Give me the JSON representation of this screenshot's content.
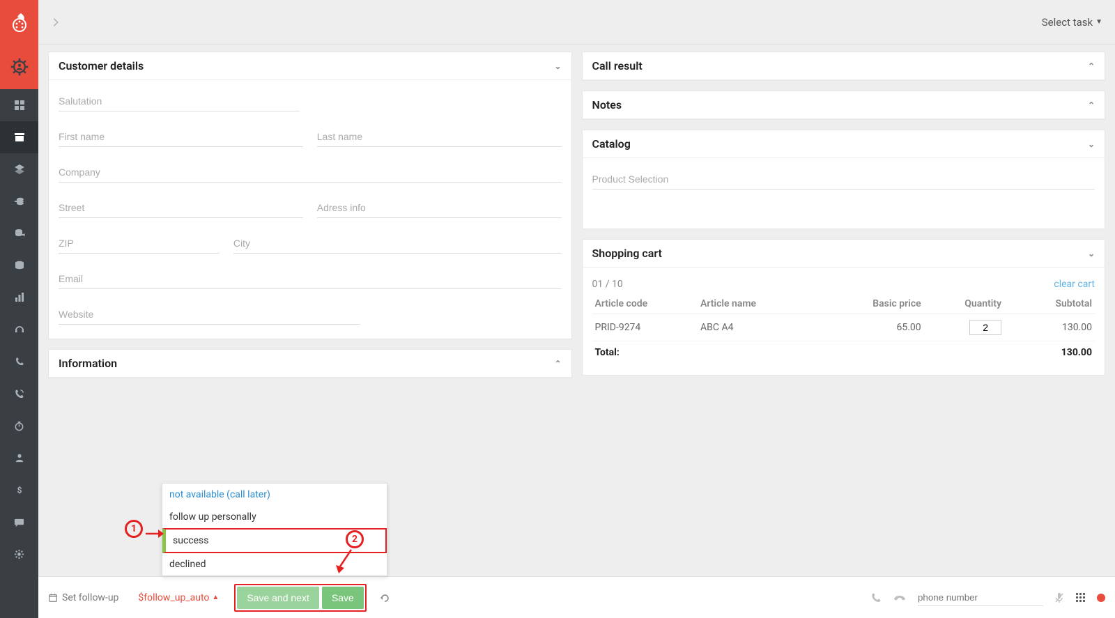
{
  "topbar": {
    "task_select": "Select task"
  },
  "panels": {
    "customer_details": {
      "title": "Customer details"
    },
    "information": {
      "title": "Information"
    },
    "call_result": {
      "title": "Call result"
    },
    "notes": {
      "title": "Notes"
    },
    "catalog": {
      "title": "Catalog"
    },
    "shopping_cart": {
      "title": "Shopping cart"
    }
  },
  "fields": {
    "salutation": "Salutation",
    "first_name": "First name",
    "last_name": "Last name",
    "company": "Company",
    "street": "Street",
    "address_info": "Adress info",
    "zip": "ZIP",
    "city": "City",
    "email": "Email",
    "website": "Website",
    "product_selection": "Product Selection",
    "phone_number": "phone number"
  },
  "cart": {
    "page_indicator": "01 / 10",
    "clear_label": "clear cart",
    "headers": {
      "code": "Article code",
      "name": "Article name",
      "price": "Basic price",
      "qty": "Quantity",
      "subtotal": "Subtotal"
    },
    "items": [
      {
        "code": "PRID-9274",
        "name": "ABC A4",
        "price": "65.00",
        "qty": "2",
        "subtotal": "130.00"
      }
    ],
    "total_label": "Total:",
    "total_value": "130.00"
  },
  "footer": {
    "set_followup": "Set follow-up",
    "followup_auto": "$follow_up_auto",
    "save_next": "Save and next",
    "save": "Save"
  },
  "popup": {
    "items": [
      {
        "label": "not available (call later)",
        "style": "blue"
      },
      {
        "label": "follow up personally",
        "style": ""
      },
      {
        "label": "success",
        "style": "highlight"
      },
      {
        "label": "declined",
        "style": ""
      }
    ]
  },
  "annotations": {
    "n1": "1",
    "n2": "2"
  }
}
